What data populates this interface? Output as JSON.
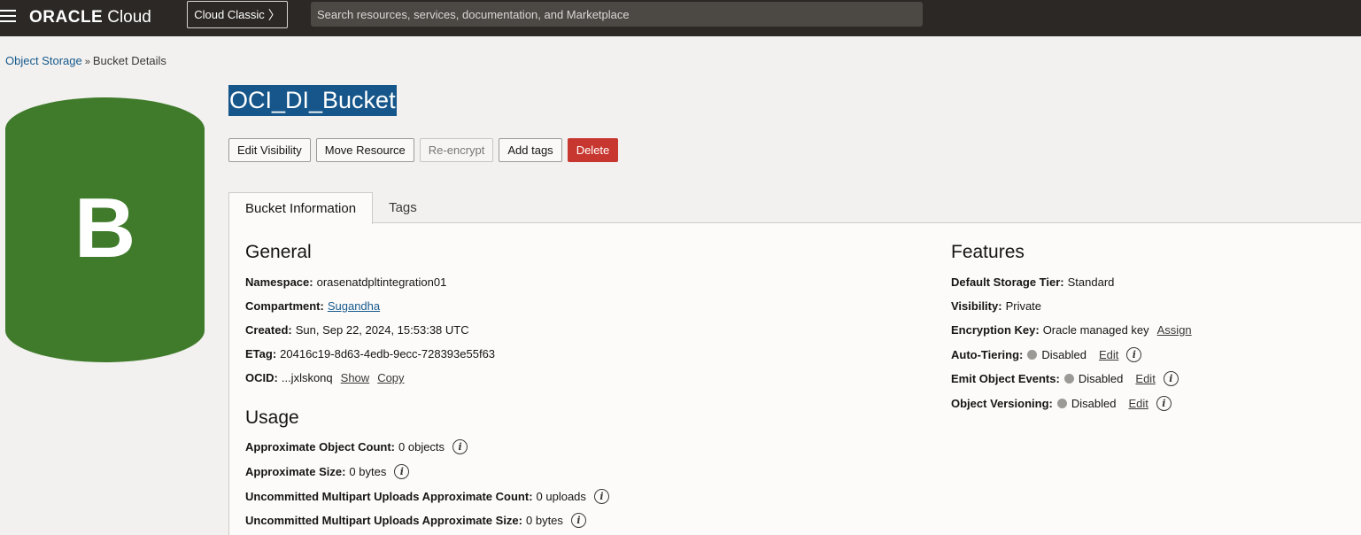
{
  "topbar": {
    "brand": "ORACLE",
    "product": "Cloud",
    "classic_label": "Cloud Classic",
    "search_placeholder": "Search resources, services, documentation, and Marketplace"
  },
  "breadcrumb": {
    "parent": "Object Storage",
    "separator": "»",
    "current": "Bucket Details"
  },
  "bucket_icon_letter": "B",
  "title": "OCI_DI_Bucket",
  "actions": {
    "edit_visibility": "Edit Visibility",
    "move_resource": "Move Resource",
    "reencrypt": "Re-encrypt",
    "add_tags": "Add tags",
    "delete": "Delete"
  },
  "tabs": {
    "bucket_info": "Bucket Information",
    "tags": "Tags"
  },
  "general": {
    "heading": "General",
    "namespace_label": "Namespace:",
    "namespace_value": "orasenatdpltintegration01",
    "compartment_label": "Compartment:",
    "compartment_value": "Sugandha",
    "created_label": "Created:",
    "created_value": "Sun, Sep 22, 2024, 15:53:38 UTC",
    "etag_label": "ETag:",
    "etag_value": "20416c19-8d63-4edb-9ecc-728393e55f63",
    "ocid_label": "OCID:",
    "ocid_value": "...jxlskonq",
    "show": "Show",
    "copy": "Copy"
  },
  "usage": {
    "heading": "Usage",
    "object_count_label": "Approximate Object Count:",
    "object_count_value": "0 objects",
    "size_label": "Approximate Size:",
    "size_value": "0 bytes",
    "multipart_count_label": "Uncommitted Multipart Uploads Approximate Count:",
    "multipart_count_value": "0 uploads",
    "multipart_size_label": "Uncommitted Multipart Uploads Approximate Size:",
    "multipart_size_value": "0 bytes"
  },
  "features": {
    "heading": "Features",
    "storage_tier_label": "Default Storage Tier:",
    "storage_tier_value": "Standard",
    "visibility_label": "Visibility:",
    "visibility_value": "Private",
    "encryption_label": "Encryption Key:",
    "encryption_value": "Oracle managed key",
    "assign": "Assign",
    "auto_tiering_label": "Auto-Tiering:",
    "auto_tiering_value": "Disabled",
    "emit_events_label": "Emit Object Events:",
    "emit_events_value": "Disabled",
    "versioning_label": "Object Versioning:",
    "versioning_value": "Disabled",
    "edit": "Edit"
  },
  "info_glyph": "i",
  "colors": {
    "topbar": "#2b2825",
    "bucket_icon": "#3f7b2a",
    "title_highlight": "#16568a",
    "delete_button": "#c7372f",
    "link": "#16598d"
  }
}
